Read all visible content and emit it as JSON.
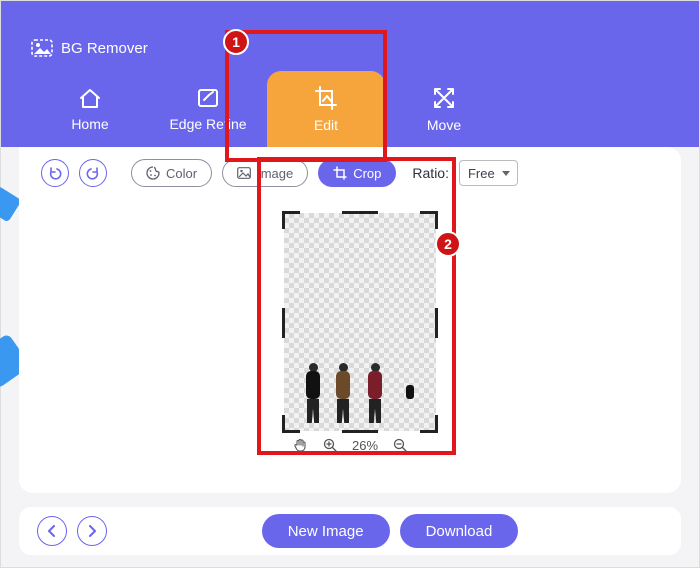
{
  "app": {
    "title": "BG Remover"
  },
  "tabs": {
    "home": {
      "label": "Home"
    },
    "edge": {
      "label": "Edge Refine"
    },
    "edit": {
      "label": "Edit"
    },
    "move": {
      "label": "Move"
    }
  },
  "toolbar": {
    "color_label": "Color",
    "image_label": "Image",
    "crop_label": "Crop",
    "ratio_label": "Ratio:",
    "ratio_value": "Free"
  },
  "zoom": {
    "value": "26%"
  },
  "footer": {
    "new_image_label": "New Image",
    "download_label": "Download"
  },
  "callouts": {
    "c1": "1",
    "c2": "2"
  }
}
